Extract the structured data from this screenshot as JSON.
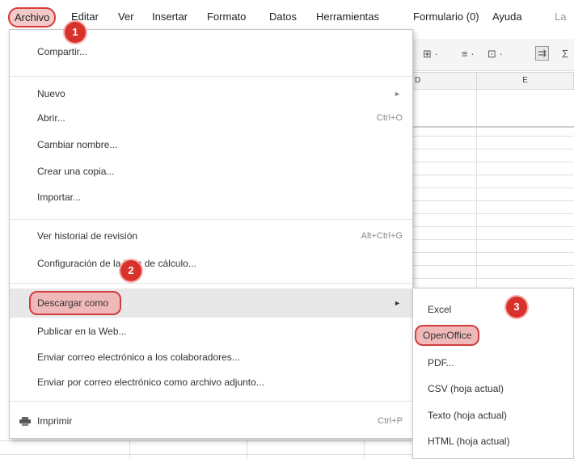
{
  "menubar": {
    "items": [
      "Archivo",
      "Editar",
      "Ver",
      "Insertar",
      "Formato",
      "Datos",
      "Herramientas",
      "Formulario (0)",
      "Ayuda",
      "La"
    ]
  },
  "toolbar": {
    "buttons": [
      "⊞ ·",
      "≡ ·",
      "⊡ ·",
      "⇉",
      "Σ"
    ]
  },
  "sheet": {
    "col_d": "D",
    "col_e": "E"
  },
  "file_menu": {
    "share": "Compartir...",
    "new": "Nuevo",
    "open": "Abrir...",
    "open_shortcut": "Ctrl+O",
    "rename": "Cambiar nombre...",
    "copy": "Crear una copia...",
    "import": "Importar...",
    "revision_history": "Ver historial de revisión",
    "revision_shortcut": "Alt+Ctrl+G",
    "sheet_settings": "Configuración de la hoja de cálculo...",
    "download_as": "Descargar como",
    "publish": "Publicar en la Web...",
    "email_collaborators": "Enviar correo electrónico a los colaboradores...",
    "email_attachment": "Enviar por correo electrónico como archivo adjunto...",
    "print": "Imprimir",
    "print_shortcut": "Ctrl+P"
  },
  "download_submenu": {
    "items": [
      "Excel",
      "OpenOffice",
      "PDF...",
      "CSV (hoja actual)",
      "Texto (hoja actual)",
      "HTML (hoja actual)"
    ]
  },
  "markers": [
    "1",
    "2",
    "3"
  ],
  "colors": {
    "highlight": "#d23c3c",
    "highlight_fill": "#f0b9b9",
    "marker": "#d9312b"
  }
}
